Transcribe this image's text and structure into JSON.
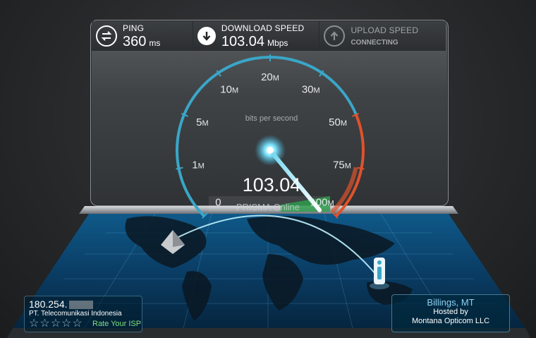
{
  "stats": {
    "ping": {
      "label": "PING",
      "value": "360",
      "unit": "ms",
      "icon": "ping-icon"
    },
    "download": {
      "label": "DOWNLOAD SPEED",
      "value": "103.04",
      "unit": "Mbps",
      "icon": "download-arrow-icon"
    },
    "upload": {
      "label": "UPLOAD SPEED",
      "status": "CONNECTING",
      "icon": "upload-arrow-icon"
    }
  },
  "gauge": {
    "units_label": "bits per second",
    "reading": "103.04",
    "ticks": [
      {
        "num": "0",
        "suffix": ""
      },
      {
        "num": "1",
        "suffix": "M"
      },
      {
        "num": "5",
        "suffix": "M"
      },
      {
        "num": "10",
        "suffix": "M"
      },
      {
        "num": "20",
        "suffix": "M"
      },
      {
        "num": "30",
        "suffix": "M"
      },
      {
        "num": "50",
        "suffix": "M"
      },
      {
        "num": "75",
        "suffix": "M"
      },
      {
        "num": "100",
        "suffix": "M"
      }
    ],
    "needle_value": 103.04,
    "colors": {
      "arc": "#3aa6c7",
      "arc_high": "#e0522b",
      "needle": "#ffffff"
    }
  },
  "watermark": "PRISMA Online",
  "isp": {
    "ip": "180.254.",
    "name": "PT. Telecomunikasi Indonesia",
    "rate_label": "Rate Your ISP",
    "star_count": 5
  },
  "server": {
    "city": "Billings, MT",
    "hosted_by": "Hosted by",
    "host": "Montana Opticom LLC"
  }
}
